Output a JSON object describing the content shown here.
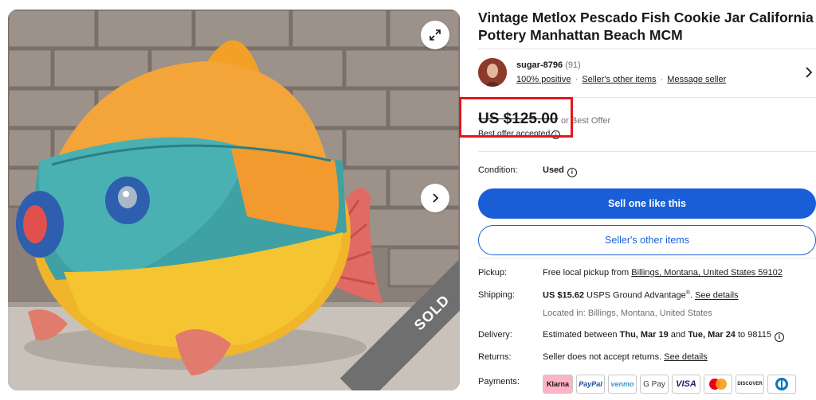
{
  "listing": {
    "title": "Vintage Metlox Pescado Fish Cookie Jar California Pottery Manhattan Beach MCM",
    "sold_label": "SOLD"
  },
  "seller": {
    "name": "sugar-8796",
    "feedback_count": "(91)",
    "positive": "100% positive",
    "other_items_link": "Seller's other items",
    "message_link": "Message seller",
    "separator": "·"
  },
  "price": {
    "amount": "US $125.00",
    "or_text": "or Best Offer",
    "offer_note": "Best offer accepted"
  },
  "condition": {
    "label": "Condition:",
    "value": "Used"
  },
  "actions": {
    "sell_one": "Sell one like this",
    "seller_other_items": "Seller's other items"
  },
  "pickup": {
    "label": "Pickup:",
    "prefix": "Free local pickup from ",
    "location": "Billings, Montana, United States 59102"
  },
  "shipping": {
    "label": "Shipping:",
    "amount": "US $15.62",
    "service": " USPS Ground Advantage",
    "reg": "®",
    "dot": ". ",
    "details_link": "See details",
    "located_in": "Located in: Billings, Montana, United States"
  },
  "delivery": {
    "label": "Delivery:",
    "prefix": "Estimated between ",
    "date_start": "Thu, Mar 19",
    "and": " and ",
    "date_end": "Tue, Mar 24",
    "suffix": " to 98115"
  },
  "returns": {
    "label": "Returns:",
    "text": "Seller does not accept returns. ",
    "details_link": "See details"
  },
  "payments": {
    "label": "Payments:",
    "methods": [
      "Klarna",
      "PayPal",
      "venmo",
      "G Pay",
      "VISA",
      "Mastercard",
      "DISCOVER",
      "Diners Club"
    ]
  },
  "colors": {
    "primary_button": "#1a5fd8",
    "highlight_box": "#e8141b",
    "sold_ribbon": "#6f6f6f"
  }
}
